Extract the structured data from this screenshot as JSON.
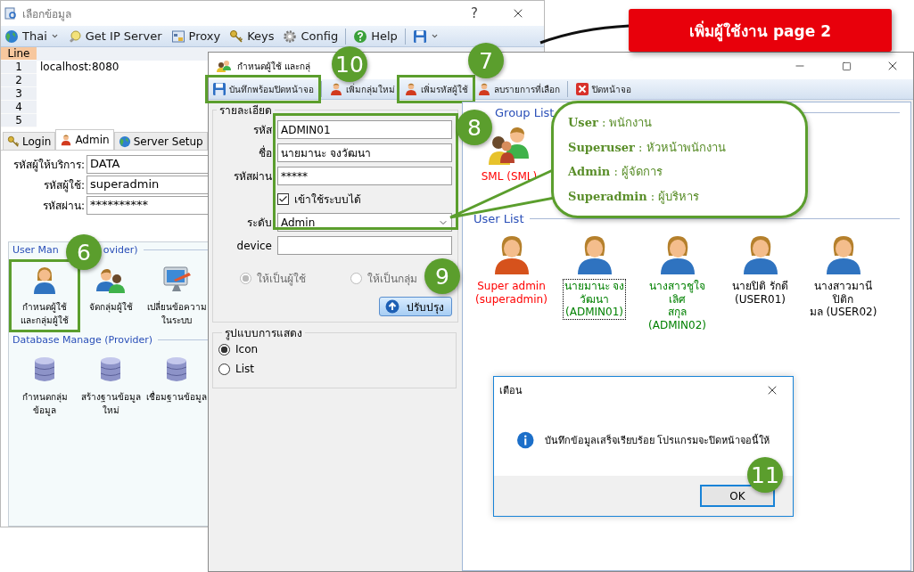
{
  "banner": {
    "text": "เพิ่มผู้ใช้งาน page 2"
  },
  "back_window": {
    "title": "เลือกข้อมูล",
    "help": "?",
    "toolbar": [
      {
        "kind": "button",
        "label": "Thai",
        "dropdown": true
      },
      {
        "kind": "button",
        "label": "Get IP Server",
        "dropdown": false
      },
      {
        "kind": "button",
        "label": "Proxy",
        "dropdown": false
      },
      {
        "kind": "button",
        "label": "Keys",
        "dropdown": false
      },
      {
        "kind": "button",
        "label": "Config",
        "dropdown": false
      },
      {
        "kind": "separator"
      },
      {
        "kind": "button",
        "label": "Help",
        "dropdown": false
      },
      {
        "kind": "separator"
      },
      {
        "kind": "button",
        "dropdown": true
      }
    ],
    "grid": {
      "column": "Line",
      "rows": [
        {
          "line": "1",
          "url": "localhost:8080"
        },
        {
          "line": "2"
        },
        {
          "line": "3"
        },
        {
          "line": "4"
        },
        {
          "line": "5"
        }
      ]
    },
    "tabs": [
      {
        "label": "Login",
        "selected": false
      },
      {
        "label": "Admin",
        "selected": true
      },
      {
        "label": "Server Setup",
        "selected": false
      }
    ],
    "fields": [
      {
        "label": "รหัสผู้ให้บริการ:",
        "value": "DATA"
      },
      {
        "label": "รหัสผู้ใช้:",
        "value": "superadmin"
      },
      {
        "label": "รหัสผ่าน:",
        "value": "**********"
      }
    ],
    "groups": [
      {
        "title": [
          "User Man",
          "ovider)"
        ],
        "items": [
          {
            "label": "กำหนดผู้ใช้\nและกลุ่มผู้ใช้"
          },
          {
            "label": "จัดกลุ่มผู้ใช้"
          },
          {
            "label": "เปลี่ยนข้อความ\nในระบบ"
          }
        ]
      },
      {
        "title": [
          "Database Manage (Provider)"
        ],
        "items": [
          {
            "label": "กำหนดกลุ่ม\nข้อมูล"
          },
          {
            "label": "สร้างฐานข้อมูล\nใหม่"
          },
          {
            "label": "เชื่อมฐานข้อมูล"
          }
        ]
      }
    ]
  },
  "front_window": {
    "title": "กำหนดผู้ใช้ และกลุ่",
    "toolbar": [
      {
        "kind": "button",
        "label": "บันทึกพร้อมปิดหน้าจอ"
      },
      {
        "kind": "separator"
      },
      {
        "kind": "button",
        "label": "เพิ่มกลุ่มใหม่"
      },
      {
        "kind": "button",
        "label": "เพิ่มรหัสผู้ใช้"
      },
      {
        "kind": "button",
        "label": "ลบรายการที่เลือก"
      },
      {
        "kind": "separator"
      },
      {
        "kind": "button",
        "label": "ปิดหน้าจอ"
      }
    ],
    "details": {
      "title": "รายละเอียด",
      "fields": [
        {
          "kind": "text",
          "label": "รหัส",
          "value": "ADMIN01"
        },
        {
          "kind": "text",
          "label": "ชื่อ",
          "value": "นายมานะ จงวัฒนา"
        },
        {
          "kind": "text",
          "label": "รหัสผ่าน",
          "value": "*****"
        },
        {
          "kind": "checkbox",
          "label": "เข้าใช้ระบบได้",
          "checked": true
        },
        {
          "kind": "select",
          "label": "ระดับ",
          "value": "Admin"
        },
        {
          "kind": "text",
          "label": "device"
        }
      ],
      "type_radios": [
        {
          "label": "ให้เป็นผู้ใช้",
          "selected": true,
          "disabled": true
        },
        {
          "label": "ให้เป็นกลุ่ม",
          "selected": false,
          "disabled": true
        }
      ],
      "button": "ปรับปรุง"
    },
    "view": {
      "title": "รูปแบบการแสดง",
      "options": [
        {
          "label": "Icon",
          "selected": true
        },
        {
          "label": "List",
          "selected": false
        }
      ]
    },
    "group_list": {
      "title": "Group List",
      "items": [
        {
          "name": "SML (SML)",
          "color": "#ff0000"
        }
      ]
    },
    "user_list": {
      "title": "User List",
      "items": [
        {
          "name": "Super admin\n(superadmin)",
          "kind": "super",
          "color": "#ff0000",
          "selected": false
        },
        {
          "name": "นายมานะ จง\nวัฒนา\n(ADMIN01)",
          "kind": "normal",
          "color": "#008000",
          "selected": true
        },
        {
          "name": "นางสาวชูใจ เลิศ\nสกุล (ADMIN02)",
          "kind": "normal",
          "color": "#008000",
          "selected": false
        },
        {
          "name": "นายปิติ รักดี\n(USER01)",
          "kind": "normal",
          "color": "#000000",
          "selected": false
        },
        {
          "name": "นางสาวมานี ปิติก\nมล (USER02)",
          "kind": "normal",
          "color": "#000000",
          "selected": false
        }
      ]
    }
  },
  "callout": {
    "entries": [
      "**User** : พนักงาน",
      "**Superuser** : หัวหน้าพนักงาน",
      "**Admin** : ผู้จัดการ",
      "**Superadmin** : ผู้บริหาร"
    ]
  },
  "dialog": {
    "title": "เตือน",
    "message": "บันทึกข้อมูลเสร็จเรียบร้อย โปรแกรมจะปิดหน้าจอนี้ให้",
    "button": "OK"
  },
  "badges": [
    "7",
    "10",
    "8",
    "6",
    "9",
    "11"
  ]
}
